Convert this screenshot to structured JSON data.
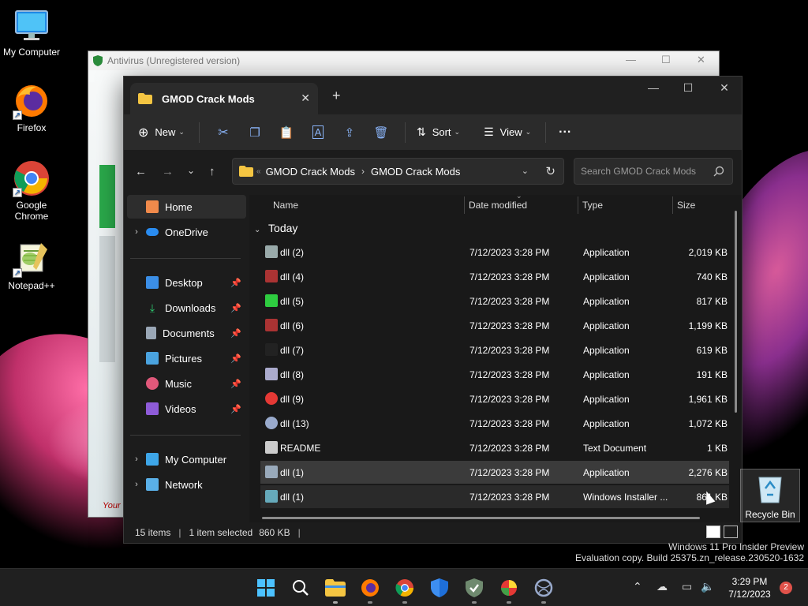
{
  "desktop": {
    "icons": [
      {
        "label": "My Computer",
        "icon": "monitor-icon"
      },
      {
        "label": "Firefox",
        "icon": "firefox-icon"
      },
      {
        "label": "Google Chrome",
        "icon": "chrome-icon"
      },
      {
        "label": "Notepad++",
        "icon": "notepadpp-icon"
      }
    ],
    "recycle_bin": "Recycle Bin",
    "watermark": {
      "line1": "Windows 11 Pro Insider Preview",
      "line2": "Evaluation copy. Build 25375.zn_release.230520-1632"
    }
  },
  "antivirus": {
    "title": "Antivirus (Unregistered version)",
    "footer_text": "Your"
  },
  "explorer": {
    "tab_title": "GMOD Crack Mods",
    "toolbar": {
      "new_label": "New",
      "sort_label": "Sort",
      "view_label": "View",
      "more_label": "···"
    },
    "address": {
      "crumbs": [
        "GMOD Crack Mods",
        "GMOD Crack Mods"
      ]
    },
    "search": {
      "placeholder": "Search GMOD Crack Mods"
    },
    "nav": {
      "home": "Home",
      "onedrive": "OneDrive",
      "desktop": "Desktop",
      "downloads": "Downloads",
      "documents": "Documents",
      "pictures": "Pictures",
      "music": "Music",
      "videos": "Videos",
      "my_computer": "My Computer",
      "network": "Network"
    },
    "columns": {
      "name": "Name",
      "date": "Date modified",
      "type": "Type",
      "size": "Size"
    },
    "group": "Today",
    "files": [
      {
        "name": "dll (2)",
        "date": "7/12/2023 3:28 PM",
        "type": "Application",
        "size": "2,019 KB",
        "icon": "shield-app-icon"
      },
      {
        "name": "dll (4)",
        "date": "7/12/2023 3:28 PM",
        "type": "Application",
        "size": "740 KB",
        "icon": "winrar-icon"
      },
      {
        "name": "dll (5)",
        "date": "7/12/2023 3:28 PM",
        "type": "Application",
        "size": "817 KB",
        "icon": "green-shield-icon"
      },
      {
        "name": "dll (6)",
        "date": "7/12/2023 3:28 PM",
        "type": "Application",
        "size": "1,199 KB",
        "icon": "winrar-icon"
      },
      {
        "name": "dll (7)",
        "date": "7/12/2023 3:28 PM",
        "type": "Application",
        "size": "619 KB",
        "icon": "blank-app-icon"
      },
      {
        "name": "dll (8)",
        "date": "7/12/2023 3:28 PM",
        "type": "Application",
        "size": "191 KB",
        "icon": "gear-app-icon"
      },
      {
        "name": "dll (9)",
        "date": "7/12/2023 3:28 PM",
        "type": "Application",
        "size": "1,961 KB",
        "icon": "ball-app-icon"
      },
      {
        "name": "dll (13)",
        "date": "7/12/2023 3:28 PM",
        "type": "Application",
        "size": "1,072 KB",
        "icon": "globe-app-icon"
      },
      {
        "name": "README",
        "date": "7/12/2023 3:28 PM",
        "type": "Text Document",
        "size": "1 KB",
        "icon": "text-doc-icon"
      },
      {
        "name": "dll (1)",
        "date": "7/12/2023 3:28 PM",
        "type": "Application",
        "size": "2,276 KB",
        "icon": "installer-app-icon"
      },
      {
        "name": "dll (1)",
        "date": "7/12/2023 3:28 PM",
        "type": "Windows Installer ...",
        "size": "861 KB",
        "icon": "msi-icon"
      }
    ],
    "status": {
      "count": "15 items",
      "selection": "1 item selected",
      "size": "860 KB"
    }
  },
  "taskbar": {
    "apps": [
      "start-icon",
      "search-icon",
      "file-explorer-icon",
      "firefox-icon",
      "chrome-icon",
      "defender-icon",
      "antivirus-icon",
      "ball-app-icon",
      "globe-app-icon"
    ],
    "time": "3:29 PM",
    "date": "7/12/2023",
    "notifications": "2"
  }
}
